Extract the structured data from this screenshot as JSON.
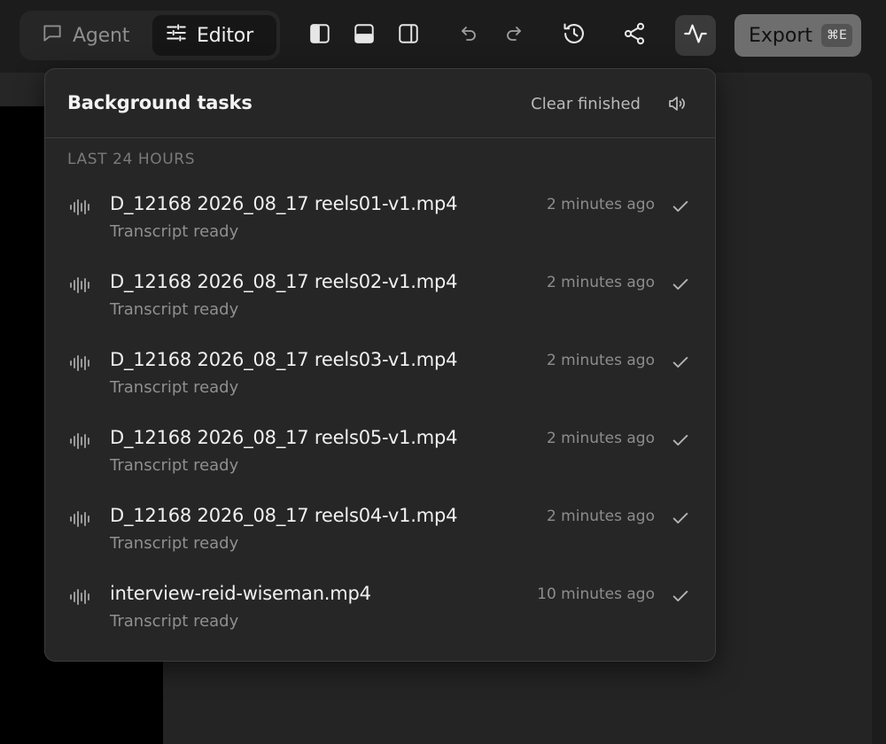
{
  "topbar": {
    "mode_tabs": [
      {
        "label": "Agent",
        "icon": "chat-bubble-icon",
        "selected": false
      },
      {
        "label": "Editor",
        "icon": "sliders-icon",
        "selected": true
      }
    ],
    "tools": [
      {
        "name": "left-panel-toggle",
        "icon": "sidebar-left-icon"
      },
      {
        "name": "bottom-panel-toggle",
        "icon": "panel-bottom-icon"
      },
      {
        "name": "right-panel-toggle",
        "icon": "sidebar-right-icon"
      },
      {
        "name": "undo",
        "icon": "undo-icon"
      },
      {
        "name": "redo",
        "icon": "redo-icon"
      },
      {
        "name": "history",
        "icon": "history-icon"
      },
      {
        "name": "share",
        "icon": "share-icon"
      },
      {
        "name": "activity",
        "icon": "activity-icon",
        "active": true
      }
    ],
    "export_label": "Export",
    "export_shortcut": "⌘E"
  },
  "popover": {
    "title": "Background tasks",
    "clear_label": "Clear finished",
    "sound_icon": "speaker-icon",
    "section_label": "LAST 24 HOURS",
    "tasks": [
      {
        "filename": "D_12168 2026_08_17 reels01-v1.mp4",
        "status": "Transcript ready",
        "time": "2 minutes ago",
        "done": true
      },
      {
        "filename": "D_12168 2026_08_17 reels02-v1.mp4",
        "status": "Transcript ready",
        "time": "2 minutes ago",
        "done": true
      },
      {
        "filename": "D_12168 2026_08_17 reels03-v1.mp4",
        "status": "Transcript ready",
        "time": "2 minutes ago",
        "done": true
      },
      {
        "filename": "D_12168 2026_08_17 reels05-v1.mp4",
        "status": "Transcript ready",
        "time": "2 minutes ago",
        "done": true
      },
      {
        "filename": "D_12168 2026_08_17 reels04-v1.mp4",
        "status": "Transcript ready",
        "time": "2 minutes ago",
        "done": true
      },
      {
        "filename": "interview-reid-wiseman.mp4",
        "status": "Transcript ready",
        "time": "10 minutes ago",
        "done": true
      }
    ]
  },
  "colors": {
    "background": "#1c1c1c",
    "popover": "#262626",
    "export_button": "#6e6e6e"
  }
}
